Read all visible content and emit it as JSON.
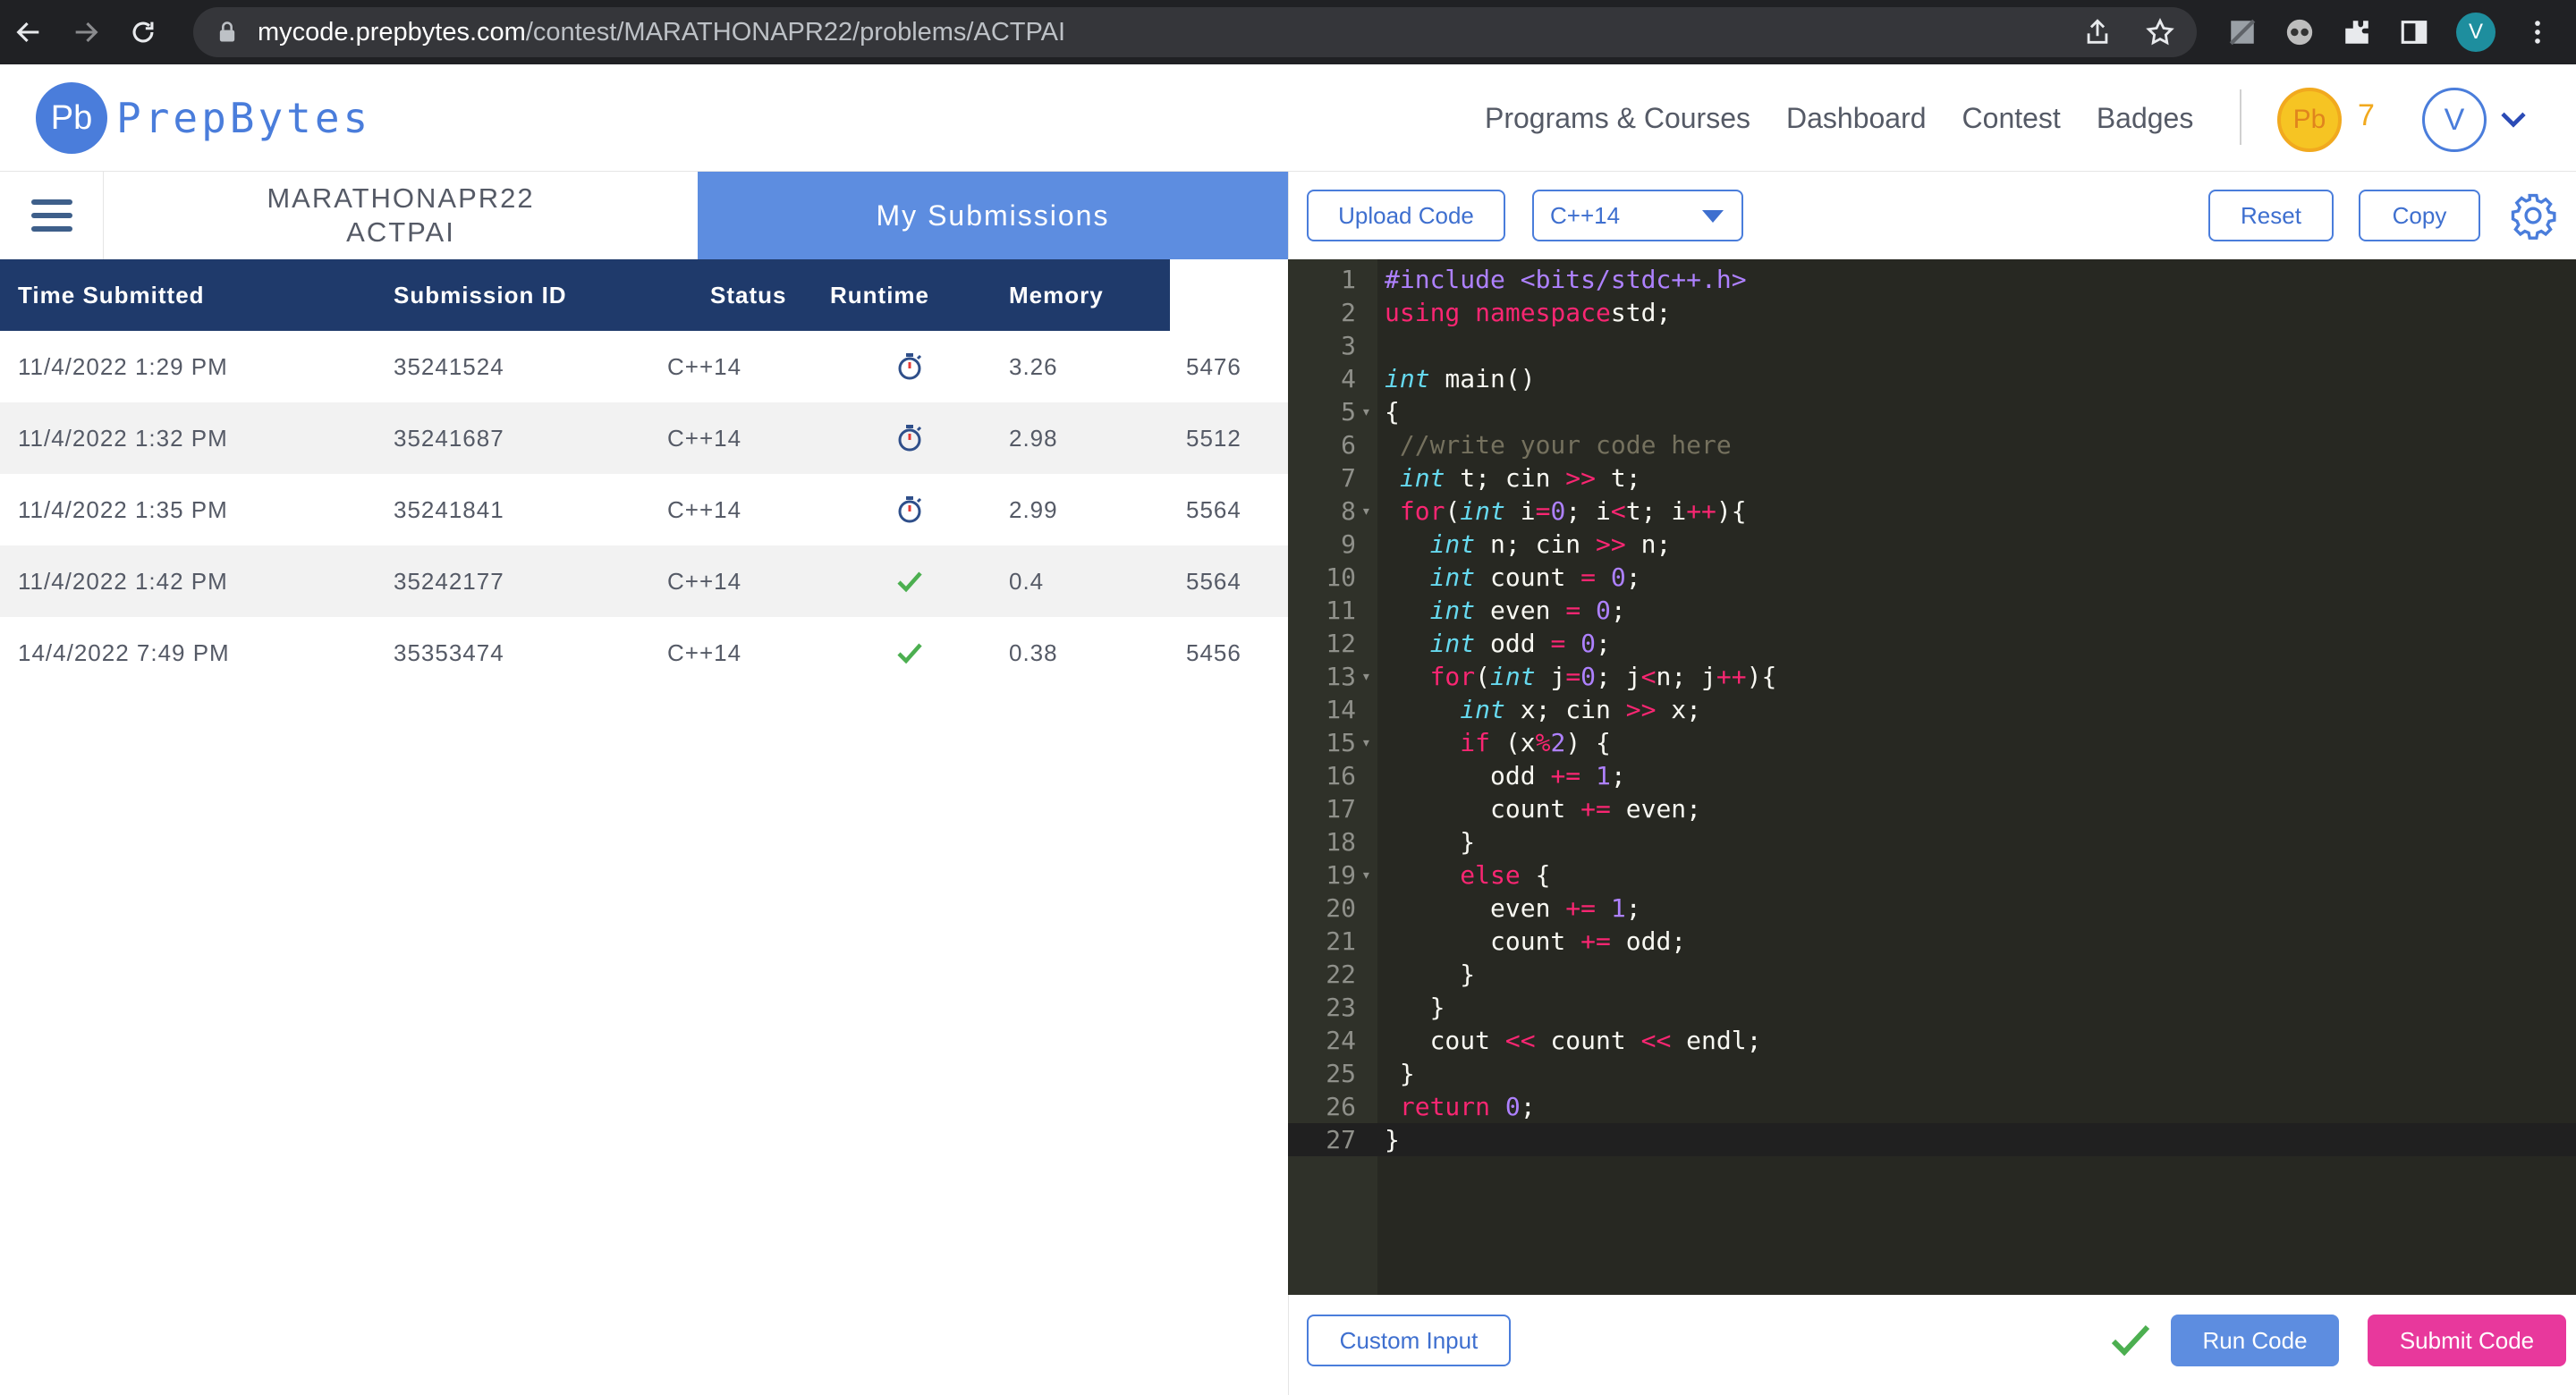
{
  "browser": {
    "url_host": "mycode.prepbytes.com",
    "url_path": "/contest/MARATHONAPR22/problems/ACTPAI",
    "profile_initial": "V"
  },
  "header": {
    "logo_mark": "Pb",
    "logo_text": "PrepBytes",
    "nav": [
      "Programs & Courses",
      "Dashboard",
      "Contest",
      "Badges"
    ],
    "coin_mark": "Pb",
    "coin_count": "7",
    "user_initial": "V"
  },
  "problem_tab": {
    "line1": "MARATHONAPR22",
    "line2": "ACTPAI"
  },
  "submissions_tab": {
    "label": "My Submissions"
  },
  "table": {
    "headers": {
      "time": "Time Submitted",
      "id": "Submission ID",
      "status": "Status",
      "runtime": "Runtime",
      "memory": "Memory"
    },
    "rows": [
      {
        "time": "11/4/2022 1:29 PM",
        "id": "35241524",
        "lang": "C++14",
        "icon": "stopwatch-icon",
        "runtime": "3.26",
        "memory": "5476"
      },
      {
        "time": "11/4/2022 1:32 PM",
        "id": "35241687",
        "lang": "C++14",
        "icon": "stopwatch-icon",
        "runtime": "2.98",
        "memory": "5512"
      },
      {
        "time": "11/4/2022 1:35 PM",
        "id": "35241841",
        "lang": "C++14",
        "icon": "stopwatch-icon",
        "runtime": "2.99",
        "memory": "5564"
      },
      {
        "time": "11/4/2022 1:42 PM",
        "id": "35242177",
        "lang": "C++14",
        "icon": "check-icon",
        "runtime": "0.4",
        "memory": "5564"
      },
      {
        "time": "14/4/2022 7:49 PM",
        "id": "35353474",
        "lang": "C++14",
        "icon": "check-icon",
        "runtime": "0.38",
        "memory": "5456"
      }
    ]
  },
  "toolbar": {
    "upload_label": "Upload Code",
    "language": "C++14",
    "reset_label": "Reset",
    "copy_label": "Copy"
  },
  "footer": {
    "custom_input_label": "Custom Input",
    "run_label": "Run Code",
    "submit_label": "Submit Code"
  },
  "colors": {
    "brand_blue": "#4a7ddb",
    "table_header": "#1f3a6b",
    "submit_pink": "#e8389c",
    "success_green": "#4caf50",
    "editor_bg": "#272822"
  },
  "code_lines": [
    [
      [
        "inc",
        "#include <bits/stdc++.h>"
      ]
    ],
    [
      [
        "k",
        "using namespace"
      ],
      [
        "",
        "std;"
      ]
    ],
    [],
    [
      [
        "t",
        "int"
      ],
      [
        "",
        " main()"
      ]
    ],
    [
      [
        "",
        "{"
      ]
    ],
    [
      [
        "",
        " "
      ],
      [
        "cm",
        "//write your code here"
      ]
    ],
    [
      [
        "",
        " "
      ],
      [
        "t",
        "int"
      ],
      [
        "",
        " t; cin "
      ],
      [
        "k",
        ">>"
      ],
      [
        "",
        " t;"
      ]
    ],
    [
      [
        "",
        " "
      ],
      [
        "k",
        "for"
      ],
      [
        "",
        "("
      ],
      [
        "t",
        "int"
      ],
      [
        "",
        " i"
      ],
      [
        "k",
        "="
      ],
      [
        "n",
        "0"
      ],
      [
        "",
        "; i"
      ],
      [
        "k",
        "<"
      ],
      [
        "",
        "t; i"
      ],
      [
        "k",
        "++"
      ],
      [
        "",
        "){"
      ]
    ],
    [
      [
        "",
        "   "
      ],
      [
        "t",
        "int"
      ],
      [
        "",
        " n; cin "
      ],
      [
        "k",
        ">>"
      ],
      [
        "",
        " n;"
      ]
    ],
    [
      [
        "",
        "   "
      ],
      [
        "t",
        "int"
      ],
      [
        "",
        " count "
      ],
      [
        "k",
        "="
      ],
      [
        "",
        " "
      ],
      [
        "n",
        "0"
      ],
      [
        "",
        ";"
      ]
    ],
    [
      [
        "",
        "   "
      ],
      [
        "t",
        "int"
      ],
      [
        "",
        " even "
      ],
      [
        "k",
        "="
      ],
      [
        "",
        " "
      ],
      [
        "n",
        "0"
      ],
      [
        "",
        ";"
      ]
    ],
    [
      [
        "",
        "   "
      ],
      [
        "t",
        "int"
      ],
      [
        "",
        " odd "
      ],
      [
        "k",
        "="
      ],
      [
        "",
        " "
      ],
      [
        "n",
        "0"
      ],
      [
        "",
        ";"
      ]
    ],
    [
      [
        "",
        "   "
      ],
      [
        "k",
        "for"
      ],
      [
        "",
        "("
      ],
      [
        "t",
        "int"
      ],
      [
        "",
        " j"
      ],
      [
        "k",
        "="
      ],
      [
        "n",
        "0"
      ],
      [
        "",
        "; j"
      ],
      [
        "k",
        "<"
      ],
      [
        "",
        "n; j"
      ],
      [
        "k",
        "++"
      ],
      [
        "",
        "){"
      ]
    ],
    [
      [
        "",
        "     "
      ],
      [
        "t",
        "int"
      ],
      [
        "",
        " x; cin "
      ],
      [
        "k",
        ">>"
      ],
      [
        "",
        " x;"
      ]
    ],
    [
      [
        "",
        "     "
      ],
      [
        "k",
        "if"
      ],
      [
        "",
        " (x"
      ],
      [
        "k",
        "%"
      ],
      [
        "n",
        "2"
      ],
      [
        "",
        ") {"
      ]
    ],
    [
      [
        "",
        "       odd "
      ],
      [
        "k",
        "+="
      ],
      [
        "",
        " "
      ],
      [
        "n",
        "1"
      ],
      [
        "",
        ";"
      ]
    ],
    [
      [
        "",
        "       count "
      ],
      [
        "k",
        "+="
      ],
      [
        "",
        " even;"
      ]
    ],
    [
      [
        "",
        "     }"
      ]
    ],
    [
      [
        "",
        "     "
      ],
      [
        "k",
        "else"
      ],
      [
        "",
        " {"
      ]
    ],
    [
      [
        "",
        "       even "
      ],
      [
        "k",
        "+="
      ],
      [
        "",
        " "
      ],
      [
        "n",
        "1"
      ],
      [
        "",
        ";"
      ]
    ],
    [
      [
        "",
        "       count "
      ],
      [
        "k",
        "+="
      ],
      [
        "",
        " odd;"
      ]
    ],
    [
      [
        "",
        "     }"
      ]
    ],
    [
      [
        "",
        "   }"
      ]
    ],
    [
      [
        "",
        "   cout "
      ],
      [
        "k",
        "<<"
      ],
      [
        "",
        " count "
      ],
      [
        "k",
        "<<"
      ],
      [
        "",
        " endl;"
      ]
    ],
    [
      [
        "",
        " }"
      ]
    ],
    [
      [
        "",
        " "
      ],
      [
        "k",
        "return"
      ],
      [
        "",
        " "
      ],
      [
        "n",
        "0"
      ],
      [
        "",
        ";"
      ]
    ],
    [
      [
        "",
        "}"
      ]
    ]
  ]
}
